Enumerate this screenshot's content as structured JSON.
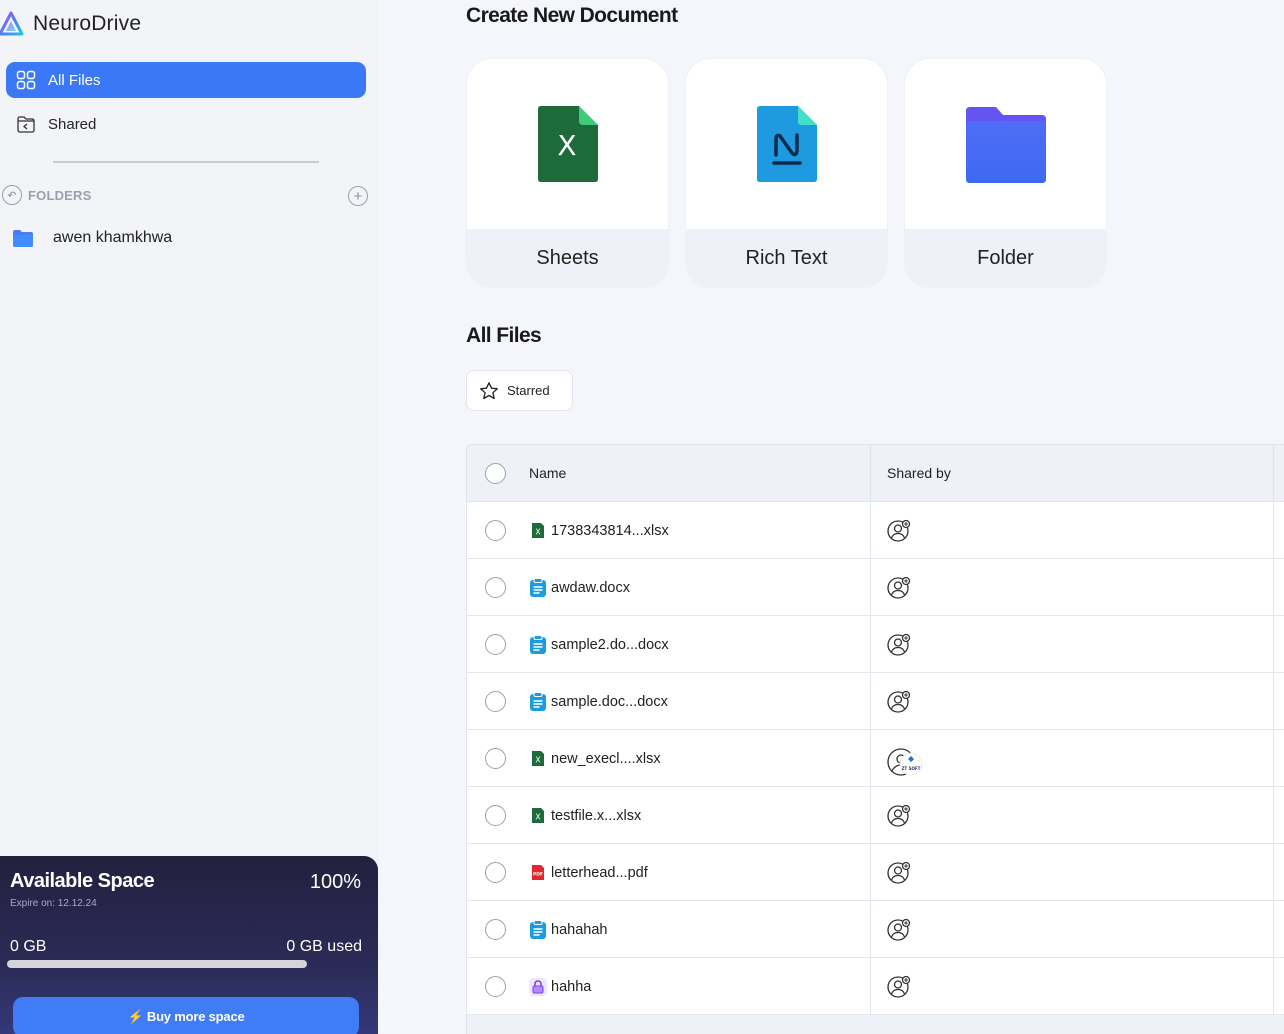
{
  "app": {
    "name": "NeuroDrive"
  },
  "sidebar": {
    "nav": [
      {
        "label": "All Files",
        "icon": "grid-icon",
        "active": true
      },
      {
        "label": "Shared",
        "icon": "shared-folder-icon",
        "active": false
      }
    ],
    "folders_label": "FOLDERS",
    "folders": [
      {
        "label": "awen khamkhwa",
        "icon": "folder-icon"
      }
    ]
  },
  "storage": {
    "title": "Available Space",
    "percent": "100%",
    "expire": "Expire on: 12.12.24",
    "available": "0 GB",
    "used": "0 GB used",
    "bar_fill_fraction": 1.0,
    "buy_label": "⚡ Buy more space"
  },
  "create": {
    "title": "Create New Document",
    "cards": [
      {
        "label": "Sheets",
        "icon": "sheets-icon"
      },
      {
        "label": "Rich Text",
        "icon": "rich-text-icon"
      },
      {
        "label": "Folder",
        "icon": "folder-icon"
      }
    ]
  },
  "files": {
    "title": "All Files",
    "filter_label": "Starred",
    "columns": {
      "name": "Name",
      "shared_by": "Shared by"
    },
    "rows": [
      {
        "name": "1738343814...xlsx",
        "type": "xlsx"
      },
      {
        "name": "awdaw.docx",
        "type": "docx"
      },
      {
        "name": "sample2.do...docx",
        "type": "docx"
      },
      {
        "name": "sample.doc...docx",
        "type": "docx"
      },
      {
        "name": "new_execl....xlsx",
        "type": "xlsx",
        "sharer_badge": "ZT SOFT"
      },
      {
        "name": "testfile.x...xlsx",
        "type": "xlsx"
      },
      {
        "name": "letterhead...pdf",
        "type": "pdf"
      },
      {
        "name": "hahahah",
        "type": "docx"
      },
      {
        "name": "hahha",
        "type": "locked"
      }
    ]
  },
  "colors": {
    "accent": "#3b78f5",
    "sheets_green": "#1d6b3a",
    "richtext_blue": "#1e9be0",
    "folder_purple": "#6355f2",
    "pdf_red": "#e2262b",
    "storage_bg": "#2b2a55"
  }
}
